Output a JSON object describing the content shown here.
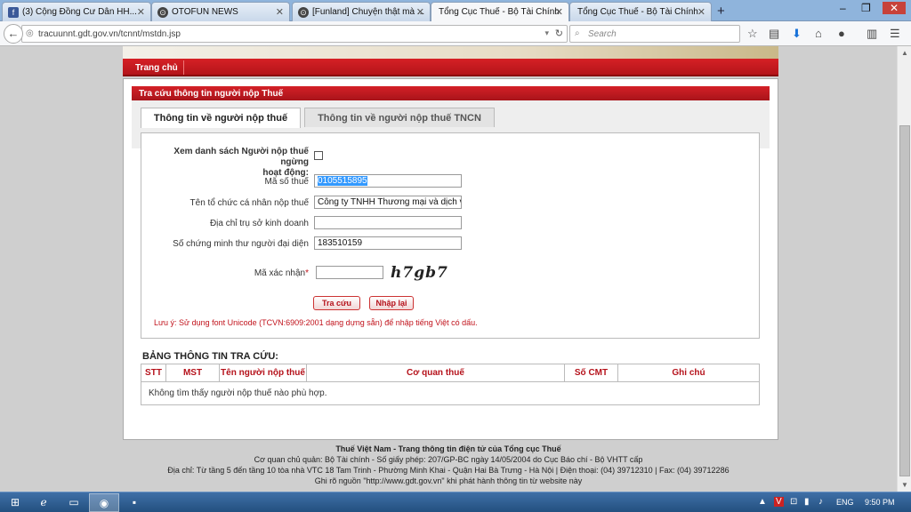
{
  "browser": {
    "tabs": [
      {
        "label": "(3) Cộng Đồng Cư Dân HH...",
        "icon": "facebook-icon",
        "active": false
      },
      {
        "label": "OTOFUN NEWS",
        "icon": "otofun-icon",
        "active": false
      },
      {
        "label": "[Funland] Chuyện thật mà ...",
        "icon": "otofun-icon",
        "active": false
      },
      {
        "label": "Tổng Cục Thuế - Bộ Tài Chính",
        "icon": "none",
        "active": true
      },
      {
        "label": "Tổng Cục Thuế - Bộ Tài Chính",
        "icon": "none",
        "active": false
      }
    ],
    "url": "tracuunnt.gdt.gov.vn/tcnnt/mstdn.jsp",
    "search_placeholder": "Search"
  },
  "site": {
    "nav_home": "Trang chủ",
    "section_title": "Tra cứu thông tin người nộp Thuế",
    "tabs": [
      "Thông tin về người nộp thuế",
      "Thông tin về người nộp thuế TNCN"
    ]
  },
  "form": {
    "stopped_label_line1": "Xem danh sách Người nộp thuế ngừng",
    "stopped_label_line2": "hoạt động:",
    "mst_label": "Mã số thuế",
    "mst_value": "0105515895",
    "name_label": "Tên tổ chức cá nhân nộp thuế",
    "name_value": "Công ty TNHH Thương mại và dịch v",
    "address_label": "Địa chỉ trụ sở kinh doanh",
    "address_value": "",
    "id_label": "Số chứng minh thư người đại diện",
    "id_value": "183510159",
    "captcha_label": "Mã xác nhận",
    "captcha_required": "*",
    "captcha_value": "",
    "captcha_image_text": "h7gb7",
    "search_button": "Tra cứu",
    "reset_button": "Nhập lại",
    "note": "Lưu ý: Sử dụng font Unicode (TCVN:6909:2001 dạng dựng sẵn) để nhập tiếng Việt có dấu."
  },
  "results": {
    "title": "BẢNG THÔNG TIN TRA CỨU:",
    "columns": [
      "STT",
      "MST",
      "Tên người nộp thuế",
      "Cơ quan thuế",
      "Số CMT",
      "Ghi chú"
    ],
    "empty_message": "Không tìm thấy người nộp thuế nào phù hợp."
  },
  "footer": {
    "line1": "Thuế Việt Nam - Trang thông tin điện tử của Tổng cục Thuế",
    "line2": "Cơ quan chủ quản: Bộ Tài chính - Số giấy phép: 207/GP-BC ngày 14/05/2004 do Cục Báo chí - Bộ VHTT cấp",
    "line3": "Địa chỉ: Từ tầng 5 đến tầng 10 tòa nhà VTC 18 Tam Trinh - Phường Minh Khai - Quận Hai Bà Trưng - Hà Nội | Điện thoại: (04) 39712310 | Fax: (04) 39712286",
    "line4": "Ghi rõ nguồn \"http://www.gdt.gov.vn\" khi phát hành thông tin từ website này"
  },
  "taskbar": {
    "language": "ENG",
    "time": "9:50 PM"
  },
  "colors": {
    "brand_red": "#c8141b",
    "selection_blue": "#3399ff"
  }
}
